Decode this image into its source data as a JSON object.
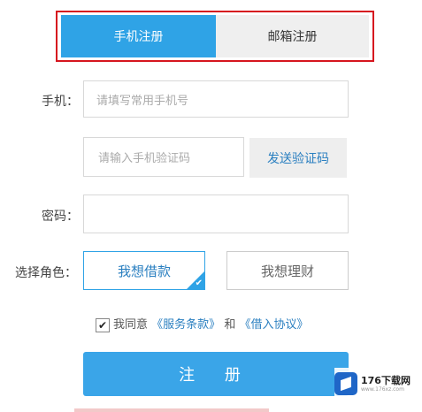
{
  "tabs": [
    {
      "label": "手机注册",
      "active": true
    },
    {
      "label": "邮箱注册",
      "active": false
    }
  ],
  "form": {
    "phone_label": "手机：",
    "phone_placeholder": "请填写常用手机号",
    "code_placeholder": "请输入手机验证码",
    "send_code_label": "发送验证码",
    "password_label": "密码：",
    "role_label": "选择角色：",
    "roles": [
      {
        "label": "我想借款",
        "selected": true
      },
      {
        "label": "我想理财",
        "selected": false
      }
    ],
    "agree_prefix": "我同意",
    "service_terms": "《服务条款》",
    "and": "和",
    "loan_agreement": "《借入协议》",
    "agreed": true,
    "submit_label": "注 册"
  },
  "watermark": {
    "text": "176下载网",
    "sub": "www.176xz.com"
  },
  "colors": {
    "accent": "#2fa3e6",
    "link": "#2a7fc0",
    "highlight_border": "#d6161f"
  }
}
